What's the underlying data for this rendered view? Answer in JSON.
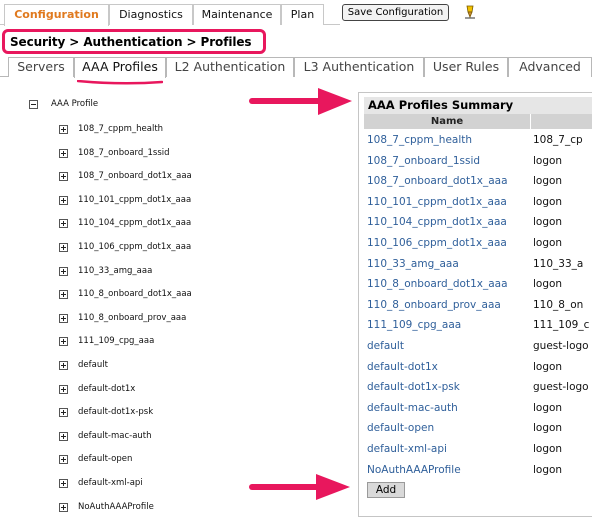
{
  "topnav": {
    "tabs": [
      {
        "label": "Configuration",
        "active": true
      },
      {
        "label": "Diagnostics",
        "active": false
      },
      {
        "label": "Maintenance",
        "active": false
      },
      {
        "label": "Plan",
        "active": false
      }
    ],
    "save_label": "Save Configuration",
    "save_icon": "pencil-icon"
  },
  "breadcrumb": "Security > Authentication > Profiles",
  "subtabs": [
    {
      "label": "Servers",
      "active": false
    },
    {
      "label": "AAA Profiles",
      "active": true
    },
    {
      "label": "L2 Authentication",
      "active": false
    },
    {
      "label": "L3 Authentication",
      "active": false
    },
    {
      "label": "User Rules",
      "active": false
    },
    {
      "label": "Advanced",
      "active": false
    }
  ],
  "tree": {
    "root": "AAA Profile",
    "items": [
      "108_7_cppm_health",
      "108_7_onboard_1ssid",
      "108_7_onboard_dot1x_aaa",
      "110_101_cppm_dot1x_aaa",
      "110_104_cppm_dot1x_aaa",
      "110_106_cppm_dot1x_aaa",
      "110_33_amg_aaa",
      "110_8_onboard_dot1x_aaa",
      "110_8_onboard_prov_aaa",
      "111_109_cpg_aaa",
      "default",
      "default-dot1x",
      "default-dot1x-psk",
      "default-mac-auth",
      "default-open",
      "default-xml-api",
      "NoAuthAAAProfile"
    ]
  },
  "summary": {
    "title": "AAA Profiles Summary",
    "column_name": "Name",
    "rows": [
      {
        "name": "108_7_cppm_health",
        "value": "108_7_cp"
      },
      {
        "name": "108_7_onboard_1ssid",
        "value": "logon"
      },
      {
        "name": "108_7_onboard_dot1x_aaa",
        "value": "logon"
      },
      {
        "name": "110_101_cppm_dot1x_aaa",
        "value": "logon"
      },
      {
        "name": "110_104_cppm_dot1x_aaa",
        "value": "logon"
      },
      {
        "name": "110_106_cppm_dot1x_aaa",
        "value": "logon"
      },
      {
        "name": "110_33_amg_aaa",
        "value": "110_33_a"
      },
      {
        "name": "110_8_onboard_dot1x_aaa",
        "value": "logon"
      },
      {
        "name": "110_8_onboard_prov_aaa",
        "value": "110_8_on"
      },
      {
        "name": "111_109_cpg_aaa",
        "value": "111_109_c"
      },
      {
        "name": "default",
        "value": "guest-logo"
      },
      {
        "name": "default-dot1x",
        "value": "logon"
      },
      {
        "name": "default-dot1x-psk",
        "value": "guest-logo"
      },
      {
        "name": "default-mac-auth",
        "value": "logon"
      },
      {
        "name": "default-open",
        "value": "logon"
      },
      {
        "name": "default-xml-api",
        "value": "logon"
      },
      {
        "name": "NoAuthAAAProfile",
        "value": "logon"
      }
    ],
    "add_label": "Add"
  },
  "colors": {
    "active_tab": "#e07a1f",
    "highlight": "#e8175d",
    "link": "#2f5f9a"
  }
}
